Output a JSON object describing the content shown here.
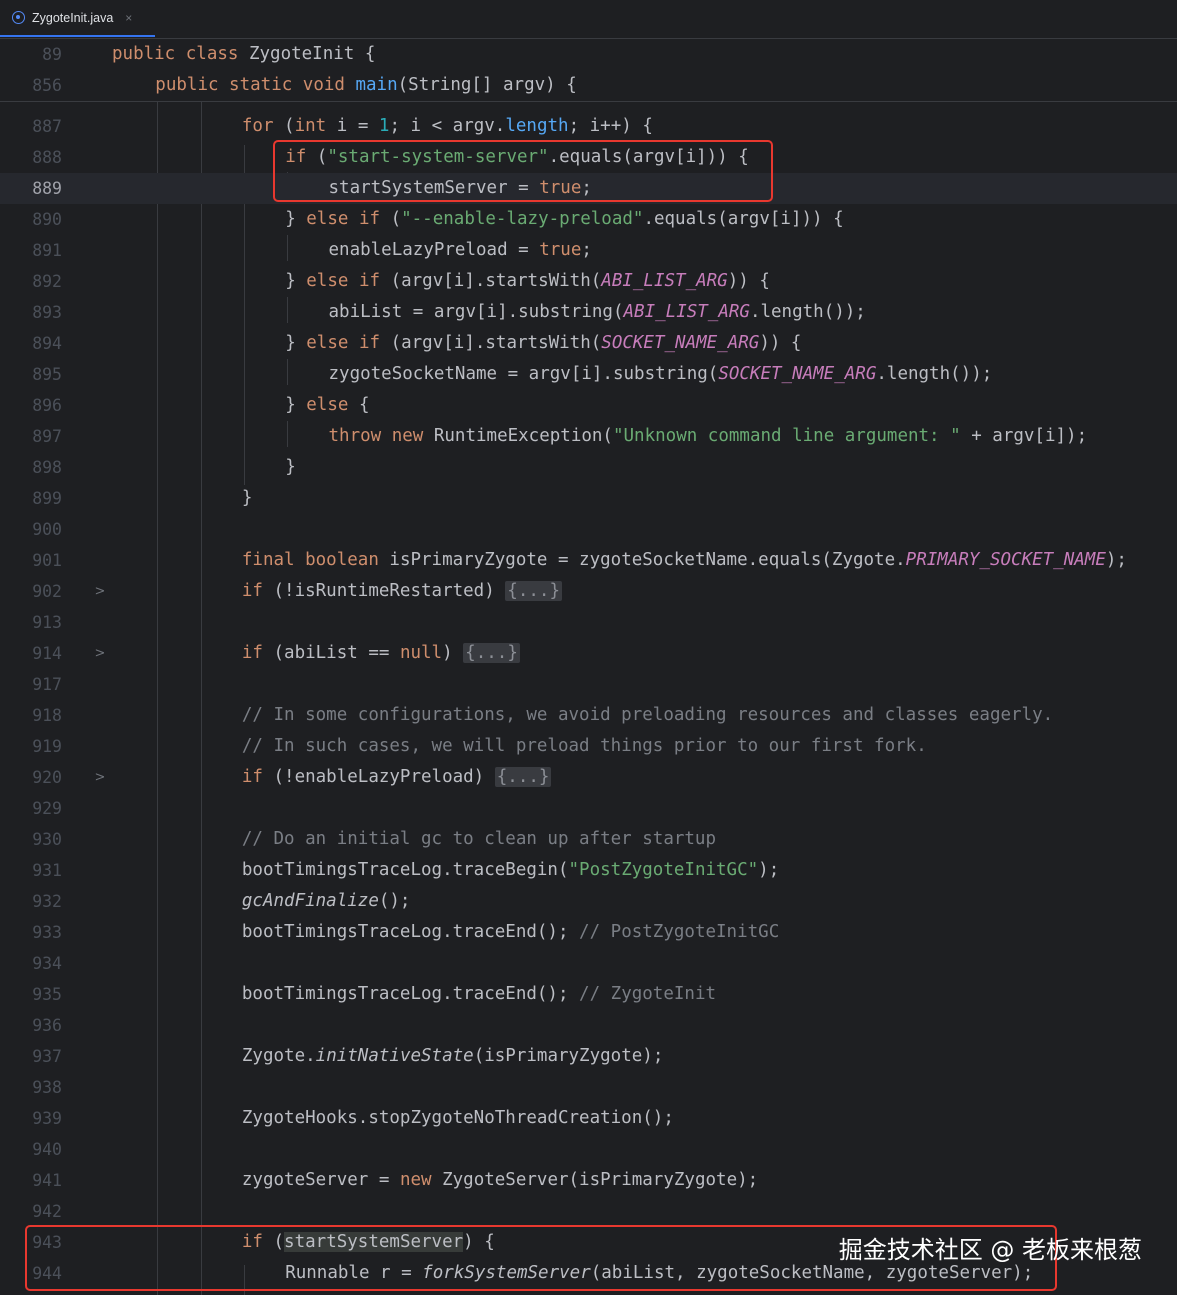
{
  "tab": {
    "title": "ZygoteInit.java",
    "close": "×",
    "icon": "java-class-icon"
  },
  "sticky": [
    {
      "ln": "89",
      "indent": 0,
      "code": [
        {
          "t": "public class ",
          "c": "kw"
        },
        {
          "t": "ZygoteInit {"
        }
      ]
    },
    {
      "ln": "856",
      "indent": 1,
      "code": [
        {
          "t": "public static void ",
          "c": "kw"
        },
        {
          "t": "main",
          "c": "fn"
        },
        {
          "t": "(String[] argv) {"
        }
      ]
    }
  ],
  "lines": [
    {
      "ln": "887",
      "indent": 3,
      "code": [
        {
          "t": "for ",
          "c": "kw"
        },
        {
          "t": "("
        },
        {
          "t": "int ",
          "c": "kw"
        },
        {
          "t": "i = "
        },
        {
          "t": "1",
          "c": "num"
        },
        {
          "t": "; i < argv."
        },
        {
          "t": "length",
          "c": "fn"
        },
        {
          "t": "; i++) {"
        }
      ]
    },
    {
      "ln": "888",
      "indent": 4,
      "code": [
        {
          "t": "if ",
          "c": "kw"
        },
        {
          "t": "("
        },
        {
          "t": "\"start-system-server\"",
          "c": "str"
        },
        {
          "t": ".equals(argv[i])) {"
        }
      ]
    },
    {
      "ln": "889",
      "indent": 5,
      "current": true,
      "code": [
        {
          "t": "startSystemServer"
        },
        {
          "t": " = "
        },
        {
          "t": "true",
          "c": "kw"
        },
        {
          "t": ";"
        }
      ]
    },
    {
      "ln": "890",
      "indent": 4,
      "code": [
        {
          "t": "} "
        },
        {
          "t": "else if ",
          "c": "kw"
        },
        {
          "t": "("
        },
        {
          "t": "\"--enable-lazy-preload\"",
          "c": "str"
        },
        {
          "t": ".equals(argv[i])) {"
        }
      ]
    },
    {
      "ln": "891",
      "indent": 5,
      "code": [
        {
          "t": "enableLazyPreload = "
        },
        {
          "t": "true",
          "c": "kw"
        },
        {
          "t": ";"
        }
      ]
    },
    {
      "ln": "892",
      "indent": 4,
      "code": [
        {
          "t": "} "
        },
        {
          "t": "else if ",
          "c": "kw"
        },
        {
          "t": "(argv[i].startsWith("
        },
        {
          "t": "ABI_LIST_ARG",
          "c": "const"
        },
        {
          "t": ")) {"
        }
      ]
    },
    {
      "ln": "893",
      "indent": 5,
      "code": [
        {
          "t": "abiList = argv[i].substring("
        },
        {
          "t": "ABI_LIST_ARG",
          "c": "const"
        },
        {
          "t": ".length());"
        }
      ]
    },
    {
      "ln": "894",
      "indent": 4,
      "code": [
        {
          "t": "} "
        },
        {
          "t": "else if ",
          "c": "kw"
        },
        {
          "t": "(argv[i].startsWith("
        },
        {
          "t": "SOCKET_NAME_ARG",
          "c": "const"
        },
        {
          "t": ")) {"
        }
      ]
    },
    {
      "ln": "895",
      "indent": 5,
      "code": [
        {
          "t": "zygoteSocketName = argv[i].substring("
        },
        {
          "t": "SOCKET_NAME_ARG",
          "c": "const"
        },
        {
          "t": ".length());"
        }
      ]
    },
    {
      "ln": "896",
      "indent": 4,
      "code": [
        {
          "t": "} "
        },
        {
          "t": "else ",
          "c": "kw"
        },
        {
          "t": "{"
        }
      ]
    },
    {
      "ln": "897",
      "indent": 5,
      "code": [
        {
          "t": "throw new ",
          "c": "kw"
        },
        {
          "t": "RuntimeException("
        },
        {
          "t": "\"Unknown command line argument: \"",
          "c": "str"
        },
        {
          "t": " + argv[i]);"
        }
      ]
    },
    {
      "ln": "898",
      "indent": 4,
      "code": [
        {
          "t": "}"
        }
      ]
    },
    {
      "ln": "899",
      "indent": 3,
      "code": [
        {
          "t": "}"
        }
      ]
    },
    {
      "ln": "900",
      "indent": 0,
      "code": []
    },
    {
      "ln": "901",
      "indent": 3,
      "code": [
        {
          "t": "final boolean ",
          "c": "kw"
        },
        {
          "t": "isPrimaryZygote = zygoteSocketName.equals(Zygote."
        },
        {
          "t": "PRIMARY_SOCKET_NAME",
          "c": "const"
        },
        {
          "t": ");"
        }
      ]
    },
    {
      "ln": "902",
      "indent": 3,
      "fold": ">",
      "code": [
        {
          "t": "if ",
          "c": "kw"
        },
        {
          "t": "(!isRuntimeRestarted) "
        },
        {
          "t": "{...}",
          "c": "folded"
        }
      ]
    },
    {
      "ln": "913",
      "indent": 0,
      "code": []
    },
    {
      "ln": "914",
      "indent": 3,
      "fold": ">",
      "code": [
        {
          "t": "if ",
          "c": "kw"
        },
        {
          "t": "(abiList == "
        },
        {
          "t": "null",
          "c": "kw"
        },
        {
          "t": ") "
        },
        {
          "t": "{...}",
          "c": "folded"
        }
      ]
    },
    {
      "ln": "917",
      "indent": 0,
      "code": []
    },
    {
      "ln": "918",
      "indent": 3,
      "code": [
        {
          "t": "// In some configurations, we avoid preloading resources and classes eagerly.",
          "c": "cmt"
        }
      ]
    },
    {
      "ln": "919",
      "indent": 3,
      "code": [
        {
          "t": "// In such cases, we will preload things prior to our first fork.",
          "c": "cmt"
        }
      ]
    },
    {
      "ln": "920",
      "indent": 3,
      "fold": ">",
      "code": [
        {
          "t": "if ",
          "c": "kw"
        },
        {
          "t": "(!enableLazyPreload) "
        },
        {
          "t": "{...}",
          "c": "folded"
        }
      ]
    },
    {
      "ln": "929",
      "indent": 0,
      "code": []
    },
    {
      "ln": "930",
      "indent": 3,
      "code": [
        {
          "t": "// Do an initial gc to clean up after startup",
          "c": "cmt"
        }
      ]
    },
    {
      "ln": "931",
      "indent": 3,
      "code": [
        {
          "t": "bootTimingsTraceLog.traceBegin("
        },
        {
          "t": "\"PostZygoteInitGC\"",
          "c": "str"
        },
        {
          "t": ");"
        }
      ]
    },
    {
      "ln": "932",
      "indent": 3,
      "code": [
        {
          "t": "gcAndFinalize",
          "c": "ital"
        },
        {
          "t": "();"
        }
      ]
    },
    {
      "ln": "933",
      "indent": 3,
      "code": [
        {
          "t": "bootTimingsTraceLog.traceEnd(); "
        },
        {
          "t": "// PostZygoteInitGC",
          "c": "cmt"
        }
      ]
    },
    {
      "ln": "934",
      "indent": 0,
      "code": []
    },
    {
      "ln": "935",
      "indent": 3,
      "code": [
        {
          "t": "bootTimingsTraceLog.traceEnd(); "
        },
        {
          "t": "// ZygoteInit",
          "c": "cmt"
        }
      ]
    },
    {
      "ln": "936",
      "indent": 0,
      "code": []
    },
    {
      "ln": "937",
      "indent": 3,
      "code": [
        {
          "t": "Zygote."
        },
        {
          "t": "initNativeState",
          "c": "ital"
        },
        {
          "t": "(isPrimaryZygote);"
        }
      ]
    },
    {
      "ln": "938",
      "indent": 0,
      "code": []
    },
    {
      "ln": "939",
      "indent": 3,
      "code": [
        {
          "t": "ZygoteHooks.stopZygoteNoThreadCreation();"
        }
      ]
    },
    {
      "ln": "940",
      "indent": 0,
      "code": []
    },
    {
      "ln": "941",
      "indent": 3,
      "code": [
        {
          "t": "zygoteServer = "
        },
        {
          "t": "new ",
          "c": "kw"
        },
        {
          "t": "ZygoteServer(isPrimaryZygote);"
        }
      ]
    },
    {
      "ln": "942",
      "indent": 0,
      "code": []
    },
    {
      "ln": "943",
      "indent": 3,
      "code": [
        {
          "t": "if ",
          "c": "kw"
        },
        {
          "t": "("
        },
        {
          "t": "startSystemServer",
          "c": "hl"
        },
        {
          "t": ") {"
        }
      ]
    },
    {
      "ln": "944",
      "indent": 4,
      "code": [
        {
          "t": "Runnable r = "
        },
        {
          "t": "forkSystemServer",
          "c": "ital"
        },
        {
          "t": "(abiList, zygoteSocketName, zygoteServer);"
        }
      ]
    }
  ],
  "watermark": "掘金技术社区 @ 老板来根葱"
}
